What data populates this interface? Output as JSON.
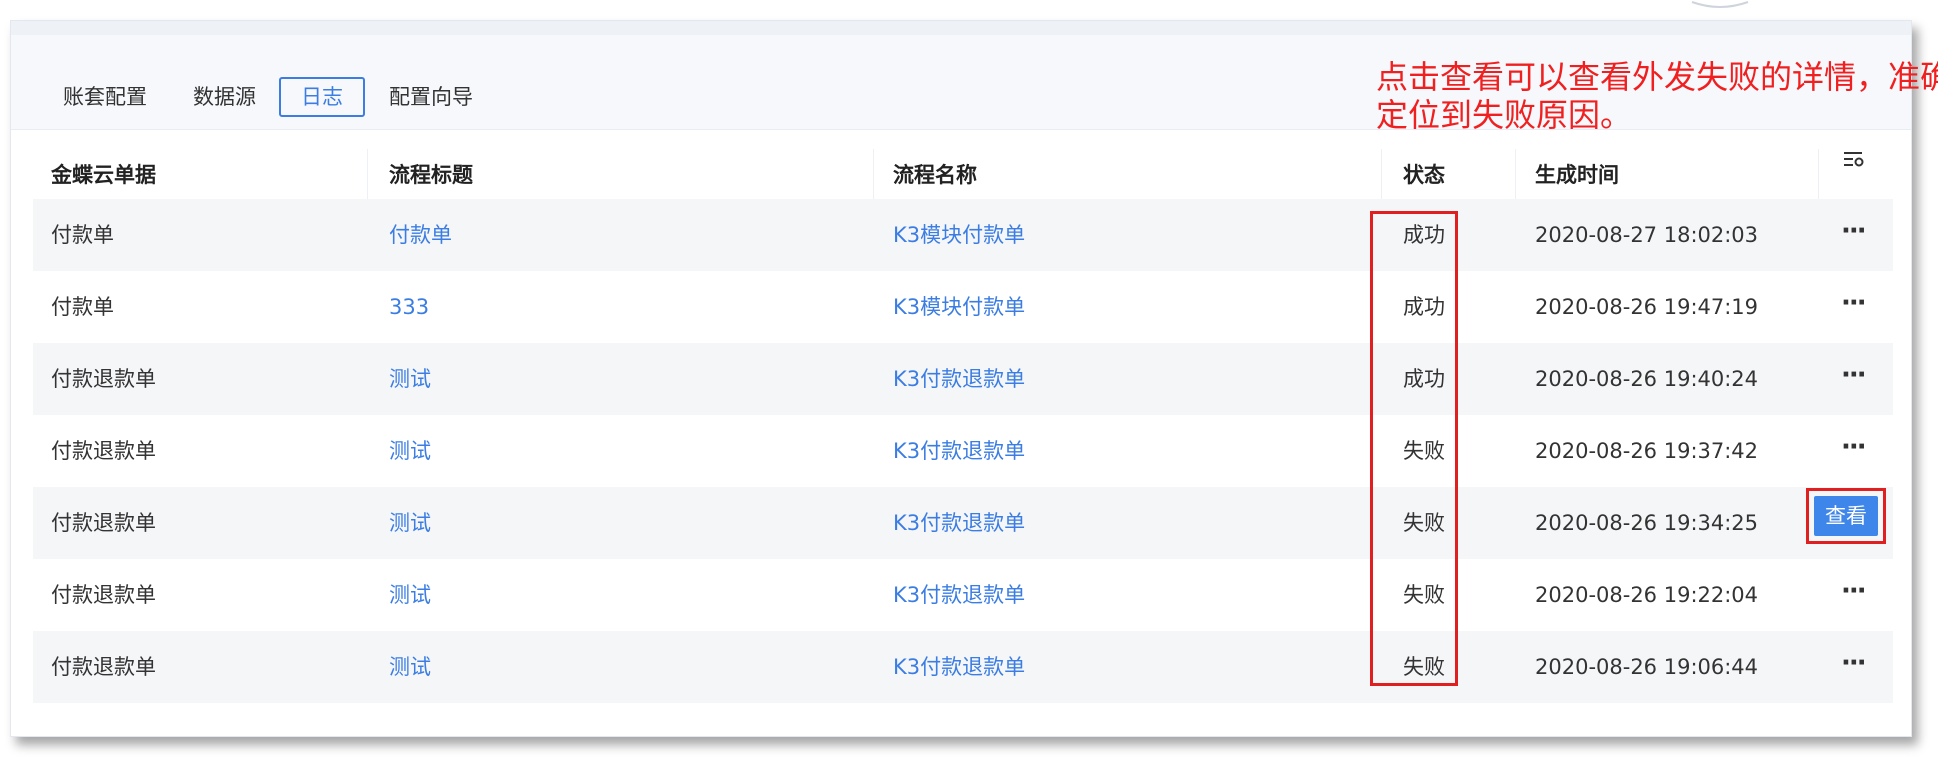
{
  "tabs": [
    "账套配置",
    "数据源",
    "日志",
    "配置向导"
  ],
  "active_tab": "日志",
  "annotation": {
    "line1": "点击查看可以查看外发失败的详情，准确",
    "line2": "定位到失败原因。"
  },
  "columns": {
    "doc": "金蝶云单据",
    "title": "流程标题",
    "name": "流程名称",
    "status": "状态",
    "time": "生成时间"
  },
  "rows": [
    {
      "doc": "付款单",
      "title": "付款单",
      "name": "K3模块付款单",
      "status": "成功",
      "time": "2020-08-27 18:02:03"
    },
    {
      "doc": "付款单",
      "title": "333",
      "name": "K3模块付款单",
      "status": "成功",
      "time": "2020-08-26 19:47:19"
    },
    {
      "doc": "付款退款单",
      "title": "测试",
      "name": "K3付款退款单",
      "status": "成功",
      "time": "2020-08-26 19:40:24"
    },
    {
      "doc": "付款退款单",
      "title": "测试",
      "name": "K3付款退款单",
      "status": "失败",
      "time": "2020-08-26 19:37:42"
    },
    {
      "doc": "付款退款单",
      "title": "测试",
      "name": "K3付款退款单",
      "status": "失败",
      "time": "2020-08-26 19:34:25"
    },
    {
      "doc": "付款退款单",
      "title": "测试",
      "name": "K3付款退款单",
      "status": "失败",
      "time": "2020-08-26 19:22:04"
    },
    {
      "doc": "付款退款单",
      "title": "测试",
      "name": "K3付款退款单",
      "status": "失败",
      "time": "2020-08-26 19:06:44"
    }
  ],
  "row_action": "···",
  "view_button": "查看",
  "colors": {
    "accent": "#3b7de3",
    "highlight": "#e02020",
    "button": "#3f86ea"
  }
}
